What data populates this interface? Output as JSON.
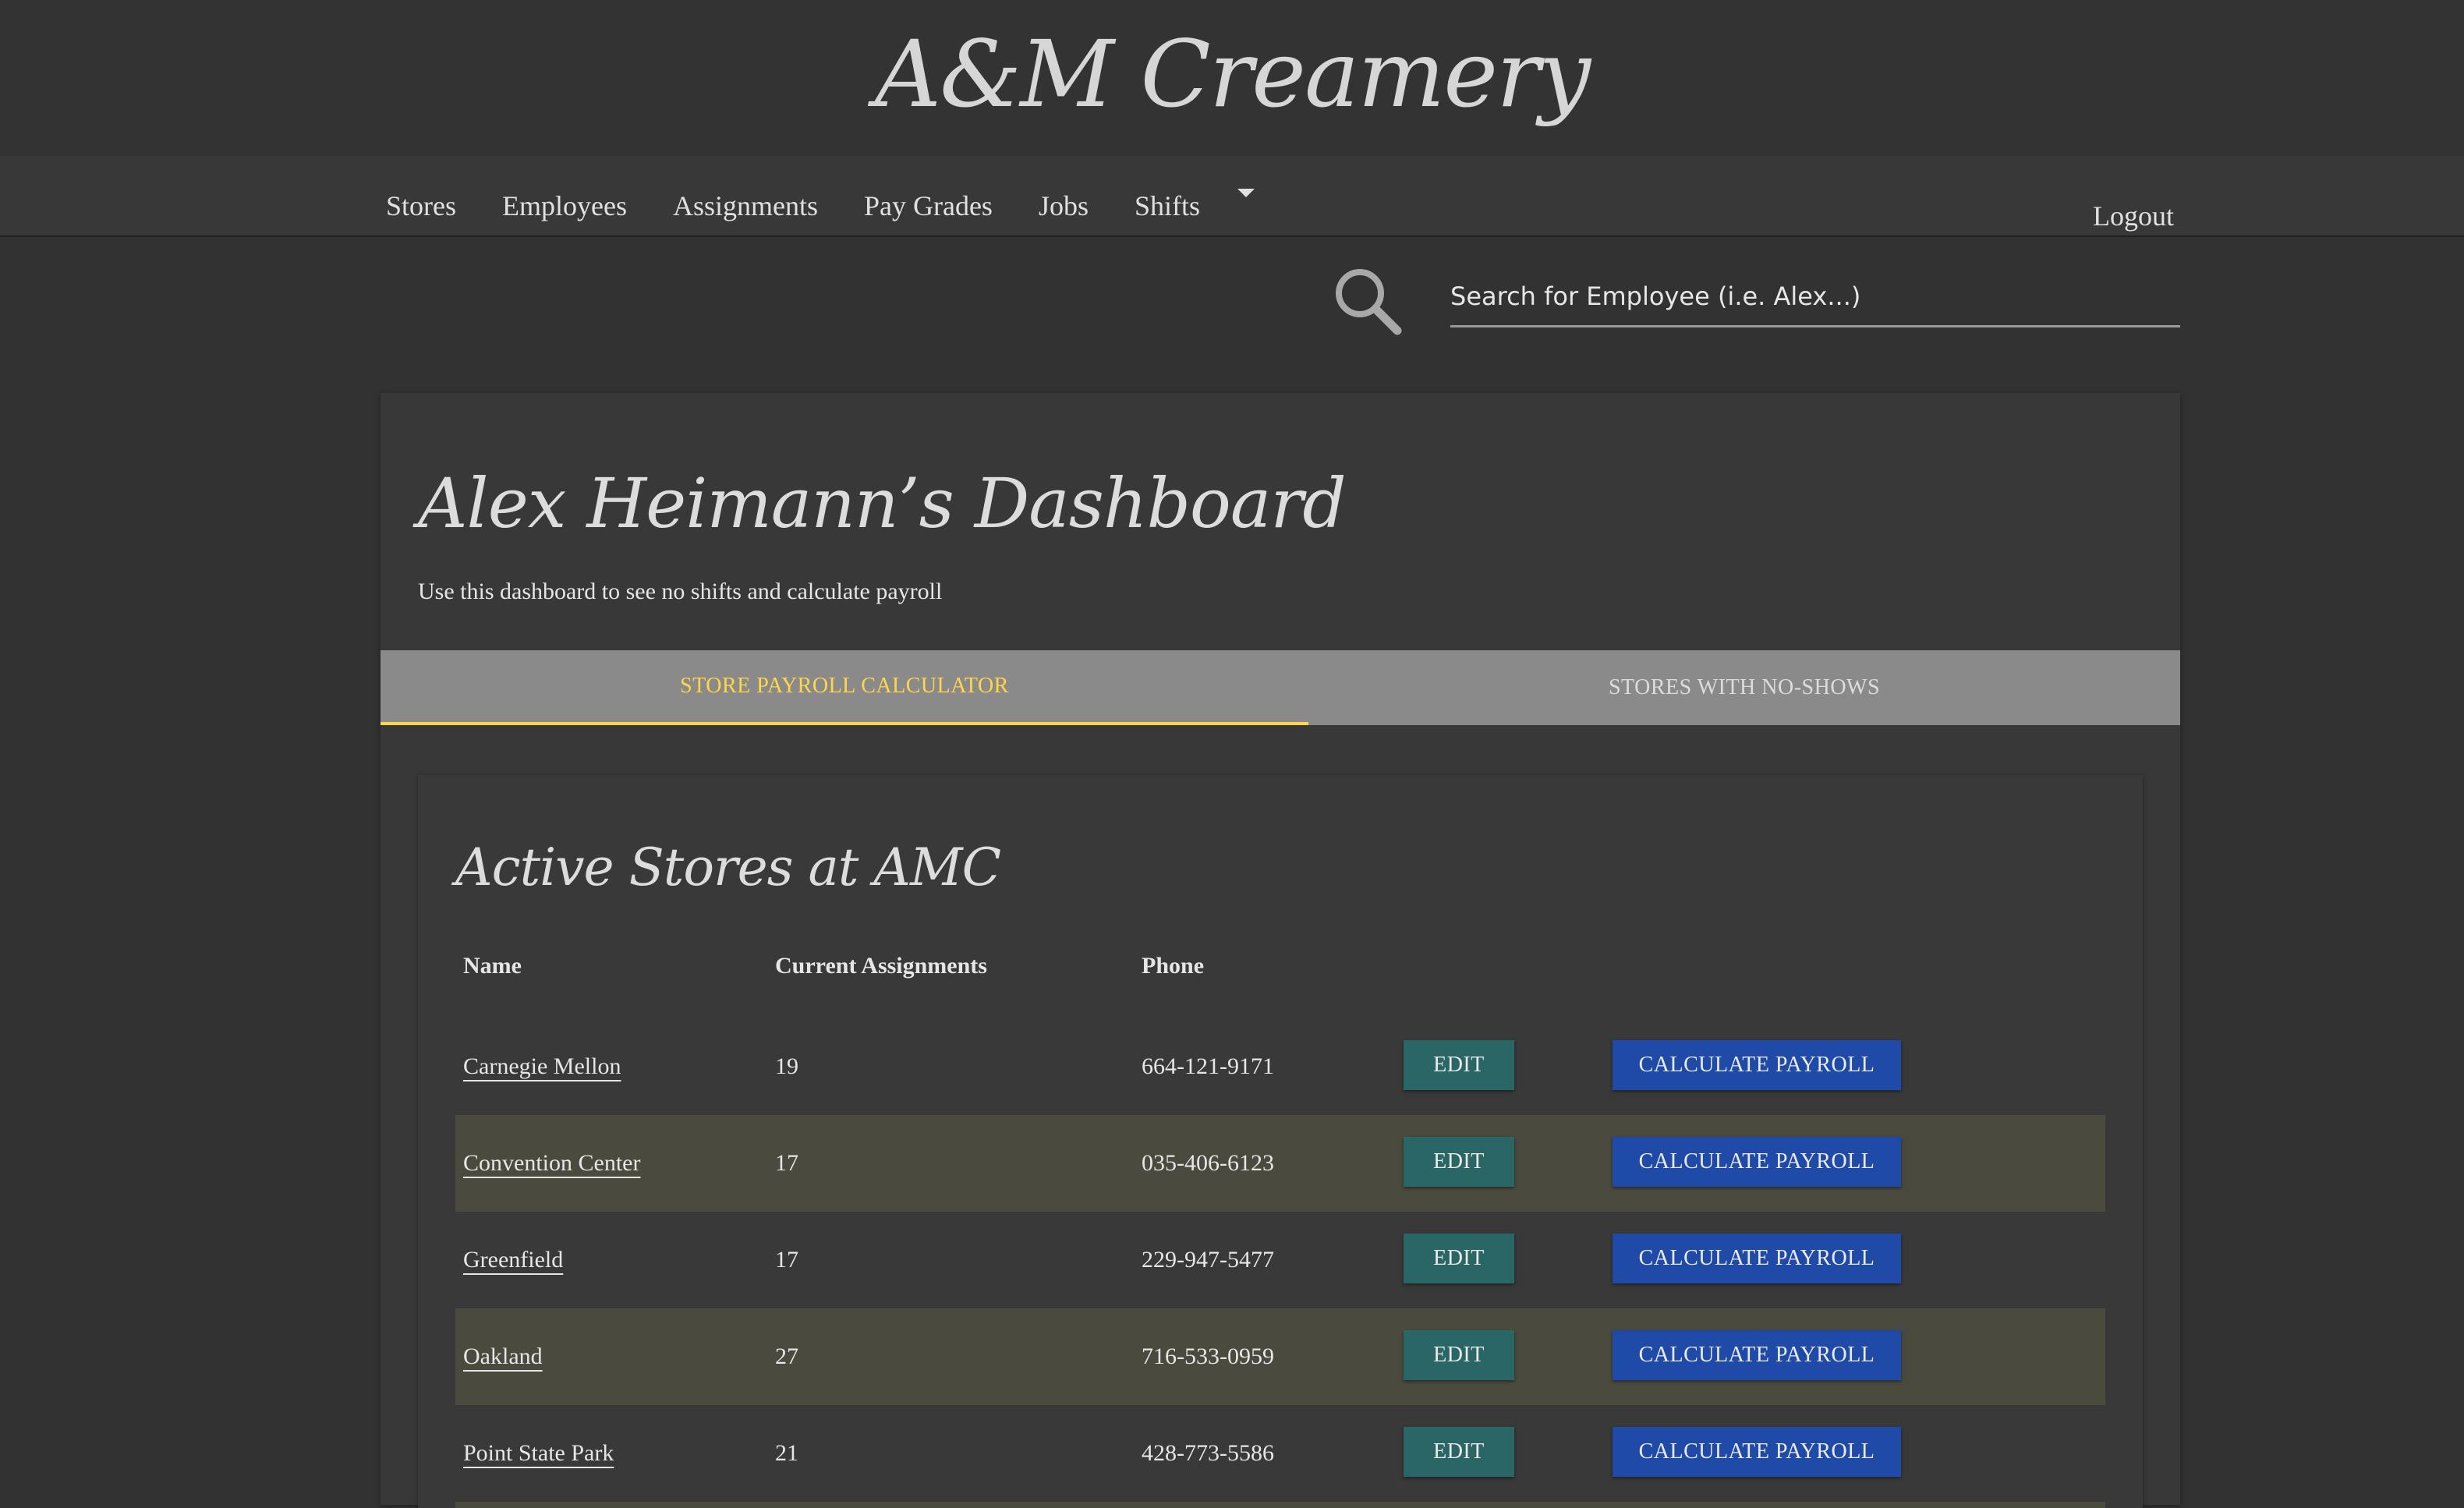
{
  "brand": "A&M Creamery",
  "nav": {
    "items": [
      "Stores",
      "Employees",
      "Assignments",
      "Pay Grades",
      "Jobs",
      "Shifts"
    ],
    "logout": "Logout"
  },
  "search": {
    "placeholder": "Search for Employee (i.e. Alex...)"
  },
  "dashboard": {
    "title": "Alex Heimann’s Dashboard",
    "subtitle": "Use this dashboard to see no shifts and calculate payroll"
  },
  "tabs": [
    {
      "label": "STORE PAYROLL CALCULATOR",
      "active": true
    },
    {
      "label": "STORES WITH NO-SHOWS",
      "active": false
    }
  ],
  "stores": {
    "title": "Active Stores at AMC",
    "headers": {
      "name": "Name",
      "assignments": "Current Assignments",
      "phone": "Phone"
    },
    "edit_label": "EDIT",
    "payroll_label": "CALCULATE PAYROLL",
    "rows": [
      {
        "name": "Carnegie Mellon",
        "assignments": "19",
        "phone": "664-121-9171"
      },
      {
        "name": "Convention Center",
        "assignments": "17",
        "phone": "035-406-6123"
      },
      {
        "name": "Greenfield",
        "assignments": "17",
        "phone": "229-947-5477"
      },
      {
        "name": "Oakland",
        "assignments": "27",
        "phone": "716-533-0959"
      },
      {
        "name": "Point State Park",
        "assignments": "21",
        "phone": "428-773-5586"
      }
    ]
  },
  "colors": {
    "background": "#323232",
    "accent_tab": "#ffd54a",
    "edit_button": "#2a6666",
    "payroll_button": "#1f4aa8",
    "row_stripe": "#4b4a3f"
  }
}
